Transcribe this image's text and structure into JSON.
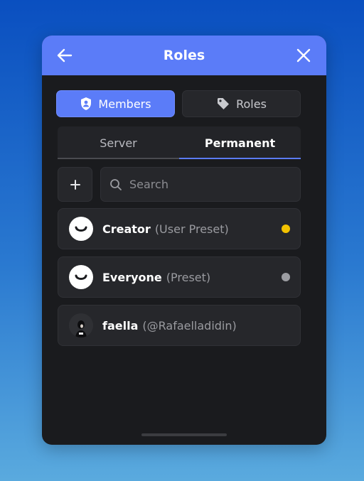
{
  "header": {
    "title": "Roles",
    "back_icon": "arrow-left-icon",
    "close_icon": "close-icon"
  },
  "segments": [
    {
      "label": "Members",
      "icon": "shield-user-icon",
      "active": true
    },
    {
      "label": "Roles",
      "icon": "tag-icon",
      "active": false
    }
  ],
  "tabs": [
    {
      "label": "Server",
      "active": false
    },
    {
      "label": "Permanent",
      "active": true
    }
  ],
  "search": {
    "placeholder": "Search",
    "value": ""
  },
  "members": [
    {
      "name": "Creator",
      "detail": "(User Preset)",
      "status_color": "#f2c200",
      "avatar": "smile"
    },
    {
      "name": "Everyone",
      "detail": "(Preset)",
      "status_color": "#9c9da2",
      "avatar": "smile"
    },
    {
      "name": "faella",
      "detail": "(@Rafaelladidin)",
      "status_color": "",
      "avatar": "photo"
    }
  ],
  "colors": {
    "accent": "#5b7cf8",
    "panel": "#1a1b1e",
    "row": "#26272b"
  }
}
